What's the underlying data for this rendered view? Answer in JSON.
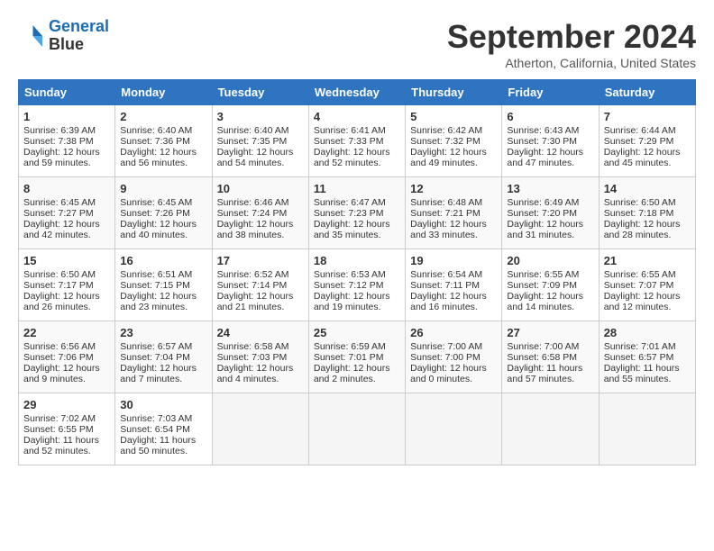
{
  "logo": {
    "line1": "General",
    "line2": "Blue"
  },
  "title": "September 2024",
  "location": "Atherton, California, United States",
  "days_of_week": [
    "Sunday",
    "Monday",
    "Tuesday",
    "Wednesday",
    "Thursday",
    "Friday",
    "Saturday"
  ],
  "weeks": [
    [
      {
        "day": "1",
        "sunrise": "Sunrise: 6:39 AM",
        "sunset": "Sunset: 7:38 PM",
        "daylight": "Daylight: 12 hours and 59 minutes."
      },
      {
        "day": "2",
        "sunrise": "Sunrise: 6:40 AM",
        "sunset": "Sunset: 7:36 PM",
        "daylight": "Daylight: 12 hours and 56 minutes."
      },
      {
        "day": "3",
        "sunrise": "Sunrise: 6:40 AM",
        "sunset": "Sunset: 7:35 PM",
        "daylight": "Daylight: 12 hours and 54 minutes."
      },
      {
        "day": "4",
        "sunrise": "Sunrise: 6:41 AM",
        "sunset": "Sunset: 7:33 PM",
        "daylight": "Daylight: 12 hours and 52 minutes."
      },
      {
        "day": "5",
        "sunrise": "Sunrise: 6:42 AM",
        "sunset": "Sunset: 7:32 PM",
        "daylight": "Daylight: 12 hours and 49 minutes."
      },
      {
        "day": "6",
        "sunrise": "Sunrise: 6:43 AM",
        "sunset": "Sunset: 7:30 PM",
        "daylight": "Daylight: 12 hours and 47 minutes."
      },
      {
        "day": "7",
        "sunrise": "Sunrise: 6:44 AM",
        "sunset": "Sunset: 7:29 PM",
        "daylight": "Daylight: 12 hours and 45 minutes."
      }
    ],
    [
      {
        "day": "8",
        "sunrise": "Sunrise: 6:45 AM",
        "sunset": "Sunset: 7:27 PM",
        "daylight": "Daylight: 12 hours and 42 minutes."
      },
      {
        "day": "9",
        "sunrise": "Sunrise: 6:45 AM",
        "sunset": "Sunset: 7:26 PM",
        "daylight": "Daylight: 12 hours and 40 minutes."
      },
      {
        "day": "10",
        "sunrise": "Sunrise: 6:46 AM",
        "sunset": "Sunset: 7:24 PM",
        "daylight": "Daylight: 12 hours and 38 minutes."
      },
      {
        "day": "11",
        "sunrise": "Sunrise: 6:47 AM",
        "sunset": "Sunset: 7:23 PM",
        "daylight": "Daylight: 12 hours and 35 minutes."
      },
      {
        "day": "12",
        "sunrise": "Sunrise: 6:48 AM",
        "sunset": "Sunset: 7:21 PM",
        "daylight": "Daylight: 12 hours and 33 minutes."
      },
      {
        "day": "13",
        "sunrise": "Sunrise: 6:49 AM",
        "sunset": "Sunset: 7:20 PM",
        "daylight": "Daylight: 12 hours and 31 minutes."
      },
      {
        "day": "14",
        "sunrise": "Sunrise: 6:50 AM",
        "sunset": "Sunset: 7:18 PM",
        "daylight": "Daylight: 12 hours and 28 minutes."
      }
    ],
    [
      {
        "day": "15",
        "sunrise": "Sunrise: 6:50 AM",
        "sunset": "Sunset: 7:17 PM",
        "daylight": "Daylight: 12 hours and 26 minutes."
      },
      {
        "day": "16",
        "sunrise": "Sunrise: 6:51 AM",
        "sunset": "Sunset: 7:15 PM",
        "daylight": "Daylight: 12 hours and 23 minutes."
      },
      {
        "day": "17",
        "sunrise": "Sunrise: 6:52 AM",
        "sunset": "Sunset: 7:14 PM",
        "daylight": "Daylight: 12 hours and 21 minutes."
      },
      {
        "day": "18",
        "sunrise": "Sunrise: 6:53 AM",
        "sunset": "Sunset: 7:12 PM",
        "daylight": "Daylight: 12 hours and 19 minutes."
      },
      {
        "day": "19",
        "sunrise": "Sunrise: 6:54 AM",
        "sunset": "Sunset: 7:11 PM",
        "daylight": "Daylight: 12 hours and 16 minutes."
      },
      {
        "day": "20",
        "sunrise": "Sunrise: 6:55 AM",
        "sunset": "Sunset: 7:09 PM",
        "daylight": "Daylight: 12 hours and 14 minutes."
      },
      {
        "day": "21",
        "sunrise": "Sunrise: 6:55 AM",
        "sunset": "Sunset: 7:07 PM",
        "daylight": "Daylight: 12 hours and 12 minutes."
      }
    ],
    [
      {
        "day": "22",
        "sunrise": "Sunrise: 6:56 AM",
        "sunset": "Sunset: 7:06 PM",
        "daylight": "Daylight: 12 hours and 9 minutes."
      },
      {
        "day": "23",
        "sunrise": "Sunrise: 6:57 AM",
        "sunset": "Sunset: 7:04 PM",
        "daylight": "Daylight: 12 hours and 7 minutes."
      },
      {
        "day": "24",
        "sunrise": "Sunrise: 6:58 AM",
        "sunset": "Sunset: 7:03 PM",
        "daylight": "Daylight: 12 hours and 4 minutes."
      },
      {
        "day": "25",
        "sunrise": "Sunrise: 6:59 AM",
        "sunset": "Sunset: 7:01 PM",
        "daylight": "Daylight: 12 hours and 2 minutes."
      },
      {
        "day": "26",
        "sunrise": "Sunrise: 7:00 AM",
        "sunset": "Sunset: 7:00 PM",
        "daylight": "Daylight: 12 hours and 0 minutes."
      },
      {
        "day": "27",
        "sunrise": "Sunrise: 7:00 AM",
        "sunset": "Sunset: 6:58 PM",
        "daylight": "Daylight: 11 hours and 57 minutes."
      },
      {
        "day": "28",
        "sunrise": "Sunrise: 7:01 AM",
        "sunset": "Sunset: 6:57 PM",
        "daylight": "Daylight: 11 hours and 55 minutes."
      }
    ],
    [
      {
        "day": "29",
        "sunrise": "Sunrise: 7:02 AM",
        "sunset": "Sunset: 6:55 PM",
        "daylight": "Daylight: 11 hours and 52 minutes."
      },
      {
        "day": "30",
        "sunrise": "Sunrise: 7:03 AM",
        "sunset": "Sunset: 6:54 PM",
        "daylight": "Daylight: 11 hours and 50 minutes."
      },
      {
        "day": "",
        "sunrise": "",
        "sunset": "",
        "daylight": ""
      },
      {
        "day": "",
        "sunrise": "",
        "sunset": "",
        "daylight": ""
      },
      {
        "day": "",
        "sunrise": "",
        "sunset": "",
        "daylight": ""
      },
      {
        "day": "",
        "sunrise": "",
        "sunset": "",
        "daylight": ""
      },
      {
        "day": "",
        "sunrise": "",
        "sunset": "",
        "daylight": ""
      }
    ]
  ]
}
